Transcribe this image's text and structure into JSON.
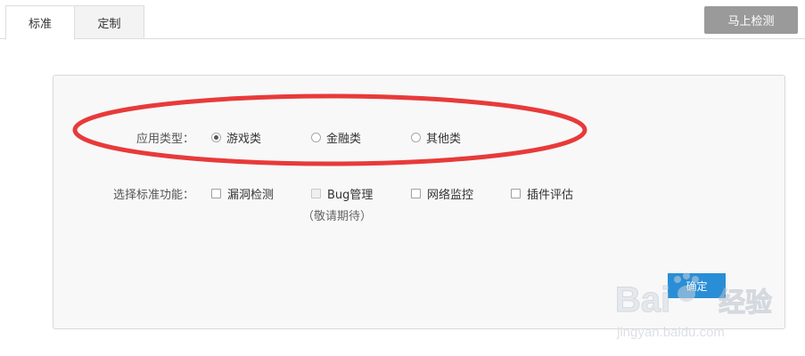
{
  "tabs": [
    {
      "label": "标准",
      "active": true
    },
    {
      "label": "定制",
      "active": false
    }
  ],
  "header": {
    "check_now_label": "马上检测"
  },
  "app_type": {
    "label": "应用类型：",
    "options": [
      {
        "label": "游戏类",
        "checked": true
      },
      {
        "label": "金融类",
        "checked": false
      },
      {
        "label": "其他类",
        "checked": false
      }
    ]
  },
  "functions": {
    "label": "选择标准功能：",
    "options": [
      {
        "label": "漏洞检测",
        "disabled": false
      },
      {
        "label": "Bug管理",
        "disabled": true,
        "note": "（敬请期待）"
      },
      {
        "label": "网络监控",
        "disabled": false
      },
      {
        "label": "插件评估",
        "disabled": false
      }
    ]
  },
  "confirm_label": "确定",
  "watermark": {
    "brand": "Baidu经验",
    "url": "jingyan.baidu.com"
  },
  "colors": {
    "annotation": "#e83a3a",
    "confirm": "#2a8ed6",
    "header_button": "#9a9a9a"
  }
}
